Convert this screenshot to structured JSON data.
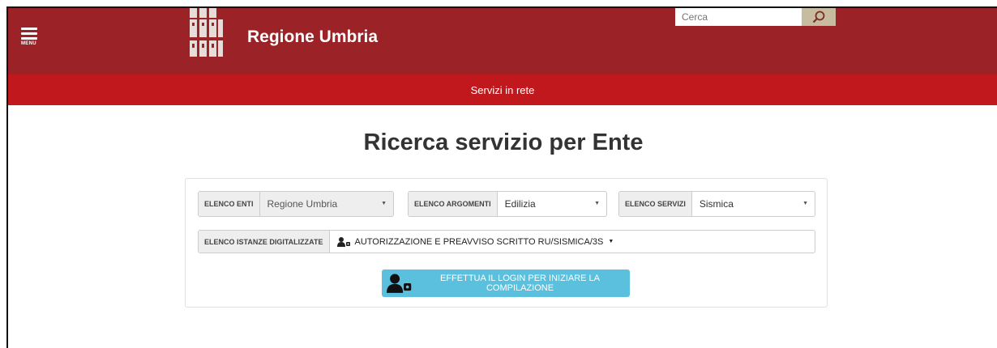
{
  "header": {
    "menu_label": "MENU",
    "site_title": "Regione Umbria",
    "search_placeholder": "Cerca"
  },
  "subnav": {
    "label": "Servizi in rete"
  },
  "main": {
    "title": "Ricerca servizio per Ente",
    "filters": {
      "enti": {
        "label": "ELENCO ENTI",
        "value": "Regione Umbria"
      },
      "argomenti": {
        "label": "ELENCO ARGOMENTI",
        "value": "Edilizia"
      },
      "servizi": {
        "label": "ELENCO SERVIZI",
        "value": "Sismica"
      },
      "istanze": {
        "label": "ELENCO ISTANZE DIGITALIZZATE",
        "value": "AUTORIZZAZIONE E PREAVVISO SCRITTO RU/SISMICA/3S"
      }
    },
    "login_button": "EFFETTUA IL LOGIN PER INIZIARE LA COMPILAZIONE"
  },
  "colors": {
    "header_bg": "#9b2226",
    "subnav_bg": "#c0181c",
    "button_bg": "#5bc0de",
    "search_button_bg": "#c8bca0"
  },
  "icons": {
    "menu": "hamburger-icon",
    "search": "search-icon",
    "user_lock": "user-lock-icon"
  }
}
